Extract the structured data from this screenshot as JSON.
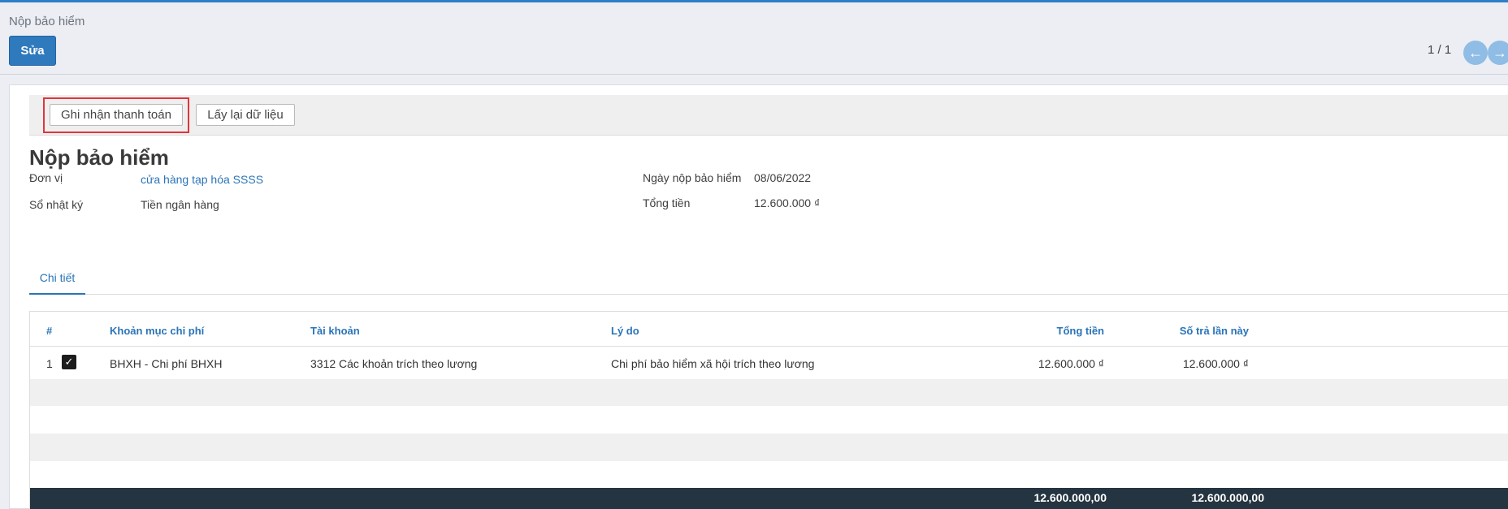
{
  "breadcrumb": "Nộp bảo hiểm",
  "toolbar": {
    "edit_label": "Sửa"
  },
  "pager": {
    "text": "1 / 1",
    "prev_icon": "arrow-left-icon",
    "next_icon": "arrow-right-icon"
  },
  "statusbar": {
    "record_payment_label": "Ghi nhận thanh toán",
    "reload_label": "Lấy lại dữ liệu"
  },
  "form": {
    "title": "Nộp bảo hiểm",
    "unit_label": "Đơn vị",
    "unit_value": "cửa hàng tạp hóa SSSS",
    "journal_label": "Sổ nhật ký",
    "journal_value": "Tiền ngân hàng",
    "date_label": "Ngày nộp bảo hiểm",
    "date_value": "08/06/2022",
    "total_label": "Tổng tiền",
    "total_value": "12.600.000 ₫"
  },
  "tabs": [
    {
      "label": "Chi tiết"
    }
  ],
  "table": {
    "headers": [
      "#",
      "Khoản mục chi phí",
      "Tài khoản",
      "Lý do",
      "Tổng tiền",
      "Số trả lần này"
    ],
    "rows": [
      {
        "index": "1",
        "checked": true,
        "expense_item": "BHXH - Chi phí BHXH",
        "account": "3312 Các khoản trích theo lương",
        "reason": "Chi phí bảo hiểm xã hội trích theo lương",
        "total": "12.600.000 ₫",
        "paid_now": "12.600.000 ₫"
      }
    ],
    "footer": {
      "total": "12.600.000,00",
      "paid_now": "12.600.000,00"
    }
  },
  "colors": {
    "accent": "#2f79bd",
    "link": "#2a74b8",
    "highlight": "#e0353b",
    "footer_bg": "#253441"
  }
}
